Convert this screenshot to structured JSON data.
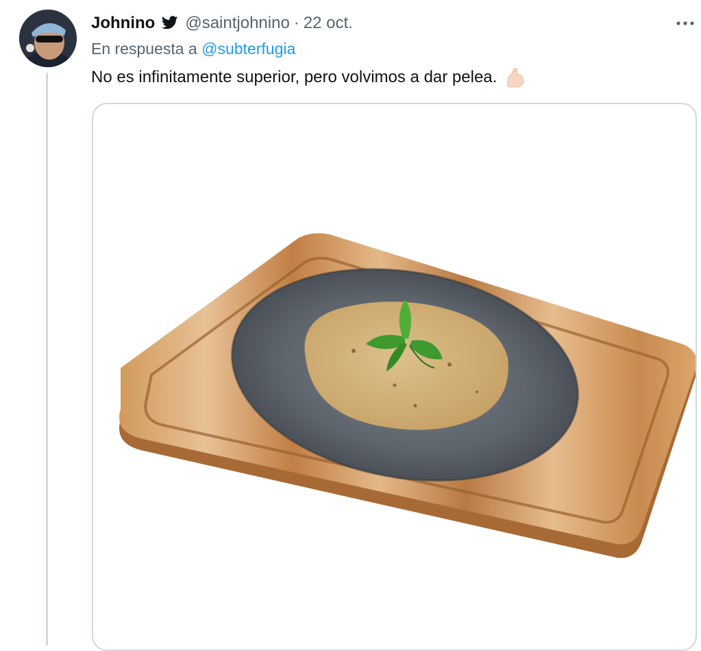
{
  "tweet": {
    "author_name": "Johnino",
    "author_handle": "@saintjohnino",
    "separator": "·",
    "date": "22 oct.",
    "reply_prefix": "En respuesta a",
    "reply_to": "@subterfugia",
    "text": "No es infinitamente superior, pero volvimos a dar pelea.",
    "emoji": "flexed-biceps-emoji",
    "verified_icon": "twitter-bird-icon",
    "menu_icon": "more-options-icon"
  },
  "media": {
    "image": "cutting-board-with-stone-plate-and-food-photo"
  },
  "colors": {
    "text": "#0f1419",
    "secondary": "#536471",
    "link": "#1d9bf0",
    "border": "#cfd9de"
  }
}
